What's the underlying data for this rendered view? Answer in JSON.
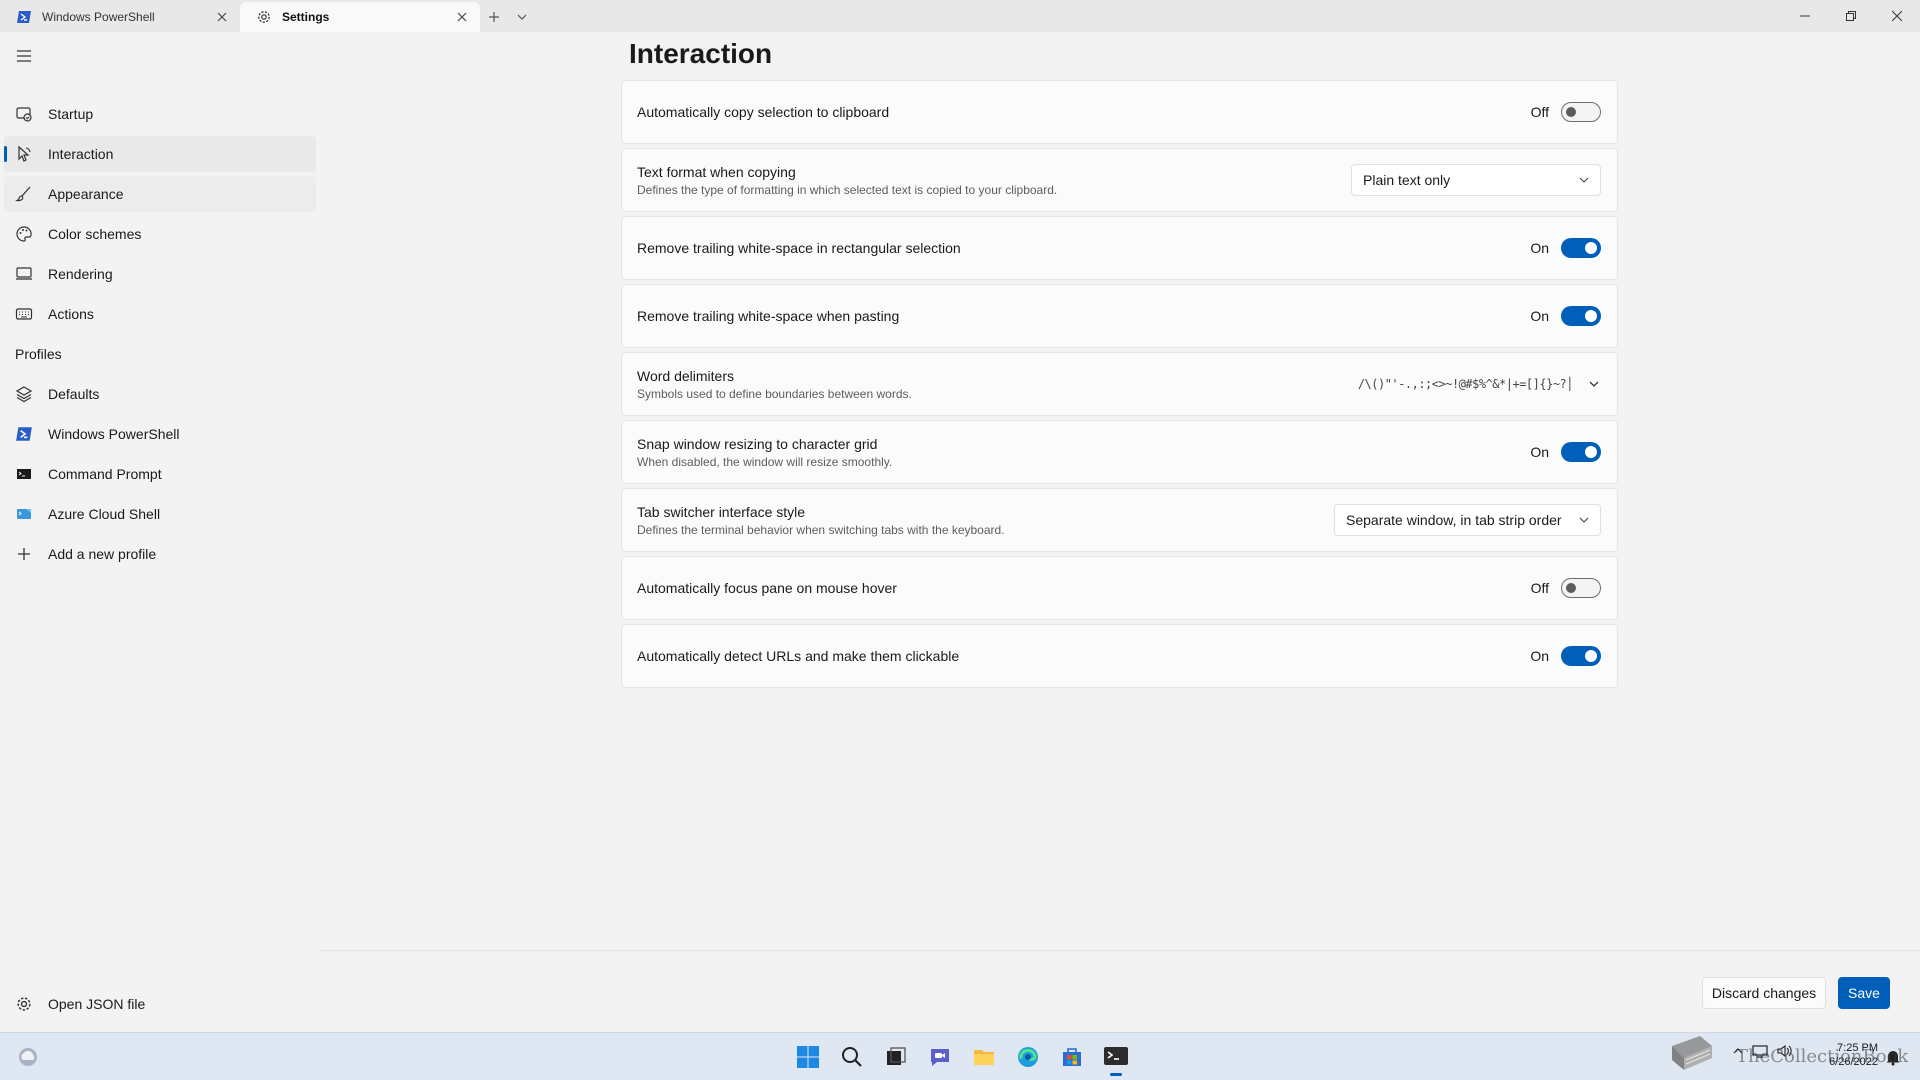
{
  "tabs": [
    {
      "title": "Windows PowerShell",
      "active": false
    },
    {
      "title": "Settings",
      "active": true
    }
  ],
  "sidebar": {
    "items": [
      {
        "id": "startup",
        "label": "Startup",
        "icon": "startup-icon"
      },
      {
        "id": "interaction",
        "label": "Interaction",
        "icon": "interaction-icon"
      },
      {
        "id": "appearance",
        "label": "Appearance",
        "icon": "paintbrush-icon"
      },
      {
        "id": "color-schemes",
        "label": "Color schemes",
        "icon": "palette-icon"
      },
      {
        "id": "rendering",
        "label": "Rendering",
        "icon": "monitor-icon"
      },
      {
        "id": "actions",
        "label": "Actions",
        "icon": "keyboard-icon"
      }
    ],
    "profiles_header": "Profiles",
    "profiles": [
      {
        "id": "defaults",
        "label": "Defaults",
        "icon": "layers-icon"
      },
      {
        "id": "windows-powershell",
        "label": "Windows PowerShell",
        "icon": "powershell-icon"
      },
      {
        "id": "command-prompt",
        "label": "Command Prompt",
        "icon": "cmd-icon"
      },
      {
        "id": "azure-cloud-shell",
        "label": "Azure Cloud Shell",
        "icon": "azure-icon"
      },
      {
        "id": "add-profile",
        "label": "Add a new profile",
        "icon": "plus-icon"
      }
    ],
    "open_json": "Open JSON file"
  },
  "page": {
    "title": "Interaction",
    "settings": [
      {
        "title": "Automatically copy selection to clipboard",
        "control": "toggle",
        "state": "Off"
      },
      {
        "title": "Text format when copying",
        "desc": "Defines the type of formatting in which selected text is copied to your clipboard.",
        "control": "dropdown",
        "value": "Plain text only"
      },
      {
        "title": "Remove trailing white-space in rectangular selection",
        "control": "toggle",
        "state": "On"
      },
      {
        "title": "Remove trailing white-space when pasting",
        "control": "toggle",
        "state": "On"
      },
      {
        "title": "Word delimiters",
        "desc": "Symbols used to define boundaries between words.",
        "control": "expander",
        "value": "/\\()\"'-.,:;<>~!@#$%^&*|+=[]{}~?│"
      },
      {
        "title": "Snap window resizing to character grid",
        "desc": "When disabled, the window will resize smoothly.",
        "control": "toggle",
        "state": "On"
      },
      {
        "title": "Tab switcher interface style",
        "desc": "Defines the terminal behavior when switching tabs with the keyboard.",
        "control": "dropdown",
        "value": "Separate window, in tab strip order"
      },
      {
        "title": "Automatically focus pane on mouse hover",
        "control": "toggle",
        "state": "Off"
      },
      {
        "title": "Automatically detect URLs and make them clickable",
        "control": "toggle",
        "state": "On"
      }
    ]
  },
  "footer": {
    "discard": "Discard changes",
    "save": "Save"
  },
  "taskbar": {
    "apps": [
      "windows-start-icon",
      "search-icon",
      "task-view-icon",
      "teams-chat-icon",
      "file-explorer-icon",
      "edge-icon",
      "store-icon",
      "terminal-icon"
    ],
    "time": "7:25 PM",
    "date": "6/26/2022"
  },
  "watermark": "TheCollectionBook",
  "colors": {
    "accent": "#005fb8",
    "background": "#f3f3f3",
    "card": "#fbfbfb"
  }
}
